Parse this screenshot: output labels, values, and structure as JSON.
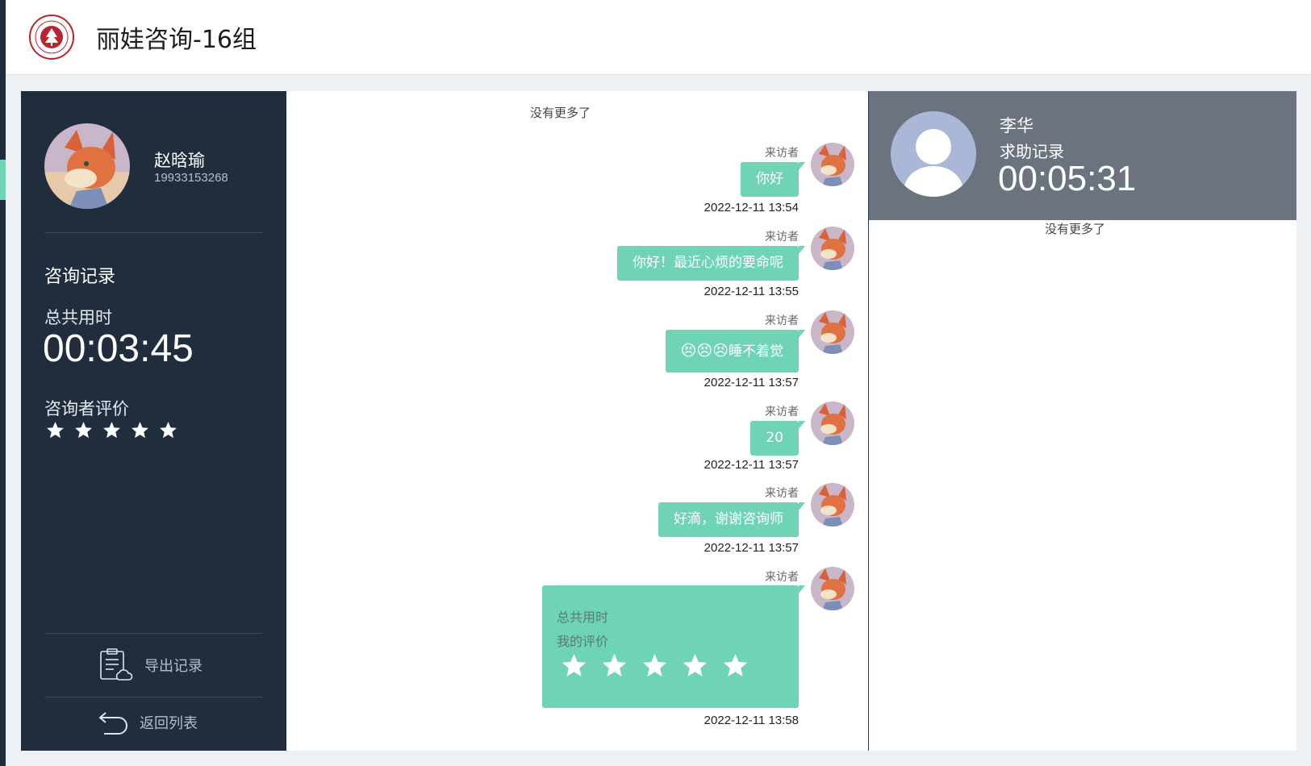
{
  "header": {
    "title": "丽娃咨询-16组",
    "logo": "university-seal-logo"
  },
  "profile": {
    "name": "赵晗瑜",
    "phone": "19933153268",
    "section_title": "咨询记录",
    "total_label": "总共用时",
    "total_time": "00:03:45",
    "rating_label": "咨询者评价",
    "rating_stars": 5,
    "export_label": "导出记录",
    "back_label": "返回列表"
  },
  "chat": {
    "no_more": "没有更多了",
    "sender": "来访者",
    "messages": [
      {
        "text": "你好",
        "time": "2022-12-11 13:54"
      },
      {
        "text": "你好！最近心烦的要命呢",
        "time": "2022-12-11 13:55"
      },
      {
        "text": "睡不着觉",
        "emoji": "😣😣😣",
        "time": "2022-12-11 13:57"
      },
      {
        "text": "20",
        "time": "2022-12-11 13:57"
      },
      {
        "text": "好滴，谢谢咨询师",
        "time": "2022-12-11 13:57"
      }
    ],
    "card": {
      "total_label": "总共用时",
      "rating_label": "我的评价",
      "stars": 5,
      "time": "2022-12-11 13:58"
    }
  },
  "right_panel": {
    "name": "李华",
    "subtitle": "求助记录",
    "time": "00:05:31",
    "no_more": "没有更多了"
  },
  "colors": {
    "dark_panel": "#1f2d3d",
    "accent_green": "#6fd3b5",
    "grey_header": "#6b737f"
  }
}
